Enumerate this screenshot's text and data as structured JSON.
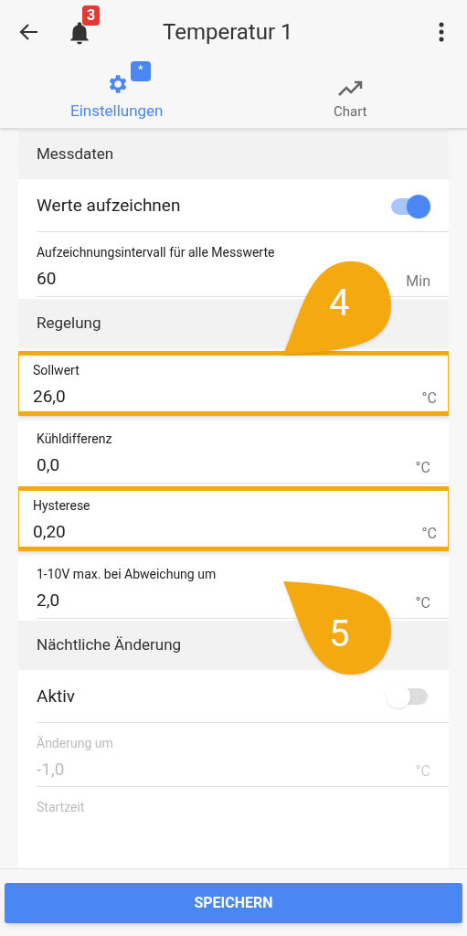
{
  "app_bar": {
    "title": "Temperatur 1",
    "notification_count": "3"
  },
  "tabs": [
    {
      "label": "Einstellungen",
      "badge": "*",
      "selected": true
    },
    {
      "label": "Chart",
      "selected": false
    }
  ],
  "rows": [
    {
      "kind": "header",
      "label": "Messdaten"
    },
    {
      "kind": "toggle",
      "label": "Werte aufzeichnen",
      "on": true,
      "disabled": false
    },
    {
      "kind": "field",
      "label": "Aufzeichnungsintervall für alle Messwerte",
      "value": "60",
      "unit": "Min",
      "highlighted": false,
      "disabled": false
    },
    {
      "kind": "header",
      "label": "Regelung"
    },
    {
      "kind": "field",
      "label": "Sollwert",
      "value": "26,0",
      "unit": "°C",
      "highlighted": true,
      "disabled": false
    },
    {
      "kind": "field",
      "label": "Kühldifferenz",
      "value": "0,0",
      "unit": "°C",
      "highlighted": false,
      "disabled": false
    },
    {
      "kind": "field",
      "label": "Hysterese",
      "value": "0,20",
      "unit": "°C",
      "highlighted": true,
      "disabled": false
    },
    {
      "kind": "field",
      "label": "1-10V max. bei Abweichung um",
      "value": "2,0",
      "unit": "°C",
      "highlighted": false,
      "disabled": false
    },
    {
      "kind": "header",
      "label": "Nächtliche Änderung"
    },
    {
      "kind": "toggle",
      "label": "Aktiv",
      "on": false,
      "disabled": false
    },
    {
      "kind": "field",
      "label": "Änderung um",
      "value": "-1,0",
      "unit": "°C",
      "highlighted": false,
      "disabled": true
    },
    {
      "kind": "label",
      "label": "Startzeit",
      "disabled": true
    }
  ],
  "callouts": [
    {
      "label": "4",
      "kind": "tipdown"
    },
    {
      "label": "5",
      "kind": "tipup"
    }
  ],
  "save_button": "SPEICHERN"
}
